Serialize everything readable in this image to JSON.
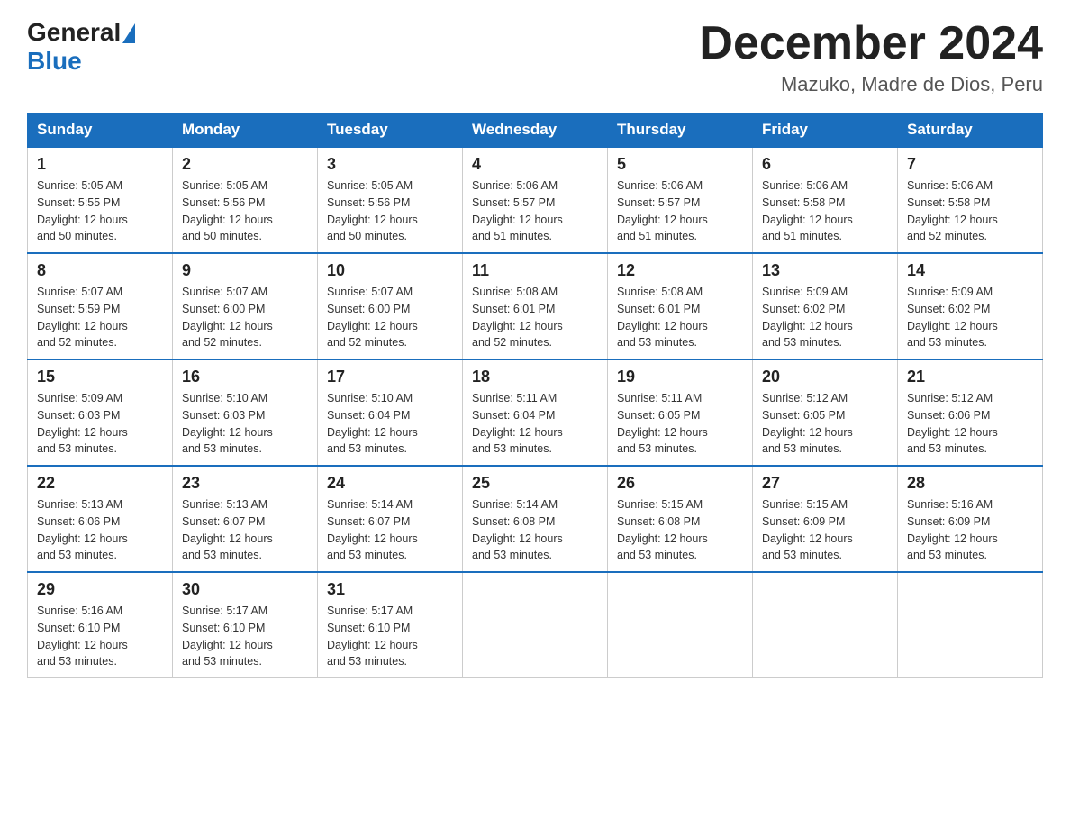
{
  "logo": {
    "general": "General",
    "blue": "Blue"
  },
  "header": {
    "title": "December 2024",
    "subtitle": "Mazuko, Madre de Dios, Peru"
  },
  "days_of_week": [
    "Sunday",
    "Monday",
    "Tuesday",
    "Wednesday",
    "Thursday",
    "Friday",
    "Saturday"
  ],
  "weeks": [
    [
      {
        "day": "1",
        "sunrise": "5:05 AM",
        "sunset": "5:55 PM",
        "daylight": "12 hours and 50 minutes."
      },
      {
        "day": "2",
        "sunrise": "5:05 AM",
        "sunset": "5:56 PM",
        "daylight": "12 hours and 50 minutes."
      },
      {
        "day": "3",
        "sunrise": "5:05 AM",
        "sunset": "5:56 PM",
        "daylight": "12 hours and 50 minutes."
      },
      {
        "day": "4",
        "sunrise": "5:06 AM",
        "sunset": "5:57 PM",
        "daylight": "12 hours and 51 minutes."
      },
      {
        "day": "5",
        "sunrise": "5:06 AM",
        "sunset": "5:57 PM",
        "daylight": "12 hours and 51 minutes."
      },
      {
        "day": "6",
        "sunrise": "5:06 AM",
        "sunset": "5:58 PM",
        "daylight": "12 hours and 51 minutes."
      },
      {
        "day": "7",
        "sunrise": "5:06 AM",
        "sunset": "5:58 PM",
        "daylight": "12 hours and 52 minutes."
      }
    ],
    [
      {
        "day": "8",
        "sunrise": "5:07 AM",
        "sunset": "5:59 PM",
        "daylight": "12 hours and 52 minutes."
      },
      {
        "day": "9",
        "sunrise": "5:07 AM",
        "sunset": "6:00 PM",
        "daylight": "12 hours and 52 minutes."
      },
      {
        "day": "10",
        "sunrise": "5:07 AM",
        "sunset": "6:00 PM",
        "daylight": "12 hours and 52 minutes."
      },
      {
        "day": "11",
        "sunrise": "5:08 AM",
        "sunset": "6:01 PM",
        "daylight": "12 hours and 52 minutes."
      },
      {
        "day": "12",
        "sunrise": "5:08 AM",
        "sunset": "6:01 PM",
        "daylight": "12 hours and 53 minutes."
      },
      {
        "day": "13",
        "sunrise": "5:09 AM",
        "sunset": "6:02 PM",
        "daylight": "12 hours and 53 minutes."
      },
      {
        "day": "14",
        "sunrise": "5:09 AM",
        "sunset": "6:02 PM",
        "daylight": "12 hours and 53 minutes."
      }
    ],
    [
      {
        "day": "15",
        "sunrise": "5:09 AM",
        "sunset": "6:03 PM",
        "daylight": "12 hours and 53 minutes."
      },
      {
        "day": "16",
        "sunrise": "5:10 AM",
        "sunset": "6:03 PM",
        "daylight": "12 hours and 53 minutes."
      },
      {
        "day": "17",
        "sunrise": "5:10 AM",
        "sunset": "6:04 PM",
        "daylight": "12 hours and 53 minutes."
      },
      {
        "day": "18",
        "sunrise": "5:11 AM",
        "sunset": "6:04 PM",
        "daylight": "12 hours and 53 minutes."
      },
      {
        "day": "19",
        "sunrise": "5:11 AM",
        "sunset": "6:05 PM",
        "daylight": "12 hours and 53 minutes."
      },
      {
        "day": "20",
        "sunrise": "5:12 AM",
        "sunset": "6:05 PM",
        "daylight": "12 hours and 53 minutes."
      },
      {
        "day": "21",
        "sunrise": "5:12 AM",
        "sunset": "6:06 PM",
        "daylight": "12 hours and 53 minutes."
      }
    ],
    [
      {
        "day": "22",
        "sunrise": "5:13 AM",
        "sunset": "6:06 PM",
        "daylight": "12 hours and 53 minutes."
      },
      {
        "day": "23",
        "sunrise": "5:13 AM",
        "sunset": "6:07 PM",
        "daylight": "12 hours and 53 minutes."
      },
      {
        "day": "24",
        "sunrise": "5:14 AM",
        "sunset": "6:07 PM",
        "daylight": "12 hours and 53 minutes."
      },
      {
        "day": "25",
        "sunrise": "5:14 AM",
        "sunset": "6:08 PM",
        "daylight": "12 hours and 53 minutes."
      },
      {
        "day": "26",
        "sunrise": "5:15 AM",
        "sunset": "6:08 PM",
        "daylight": "12 hours and 53 minutes."
      },
      {
        "day": "27",
        "sunrise": "5:15 AM",
        "sunset": "6:09 PM",
        "daylight": "12 hours and 53 minutes."
      },
      {
        "day": "28",
        "sunrise": "5:16 AM",
        "sunset": "6:09 PM",
        "daylight": "12 hours and 53 minutes."
      }
    ],
    [
      {
        "day": "29",
        "sunrise": "5:16 AM",
        "sunset": "6:10 PM",
        "daylight": "12 hours and 53 minutes."
      },
      {
        "day": "30",
        "sunrise": "5:17 AM",
        "sunset": "6:10 PM",
        "daylight": "12 hours and 53 minutes."
      },
      {
        "day": "31",
        "sunrise": "5:17 AM",
        "sunset": "6:10 PM",
        "daylight": "12 hours and 53 minutes."
      },
      null,
      null,
      null,
      null
    ]
  ],
  "labels": {
    "sunrise": "Sunrise:",
    "sunset": "Sunset:",
    "daylight": "Daylight:"
  }
}
